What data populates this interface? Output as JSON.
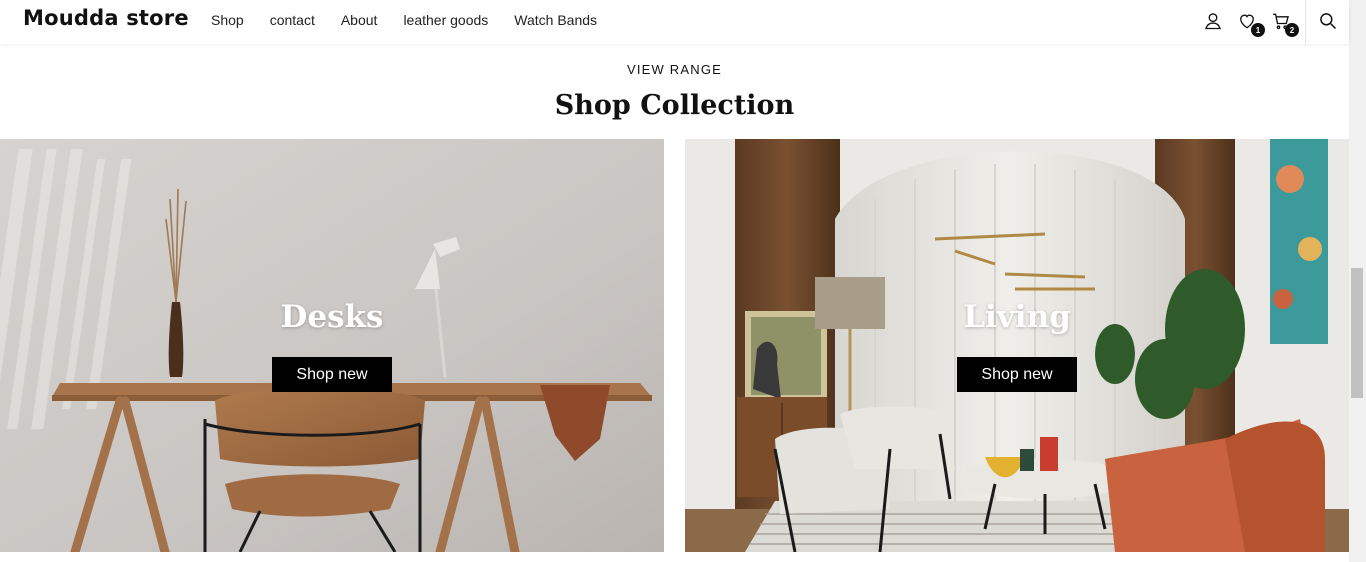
{
  "header": {
    "logo": "Moudda store",
    "nav": [
      "Shop",
      "contact",
      "About",
      "leather goods",
      "Watch Bands"
    ],
    "icons": {
      "account": "user-icon",
      "wishlist": "heart-icon",
      "cart": "cart-icon",
      "search": "search-icon"
    },
    "wishlist_count": "1",
    "cart_count": "2"
  },
  "section": {
    "eyebrow": "VIEW RANGE",
    "title": "Shop Collection"
  },
  "cards": [
    {
      "title": "Desks",
      "button": "Shop new"
    },
    {
      "title": "Living",
      "button": "Shop new"
    }
  ],
  "colors": {
    "accent": "#000000",
    "text": "#111111",
    "sofa": "#c9623f"
  }
}
